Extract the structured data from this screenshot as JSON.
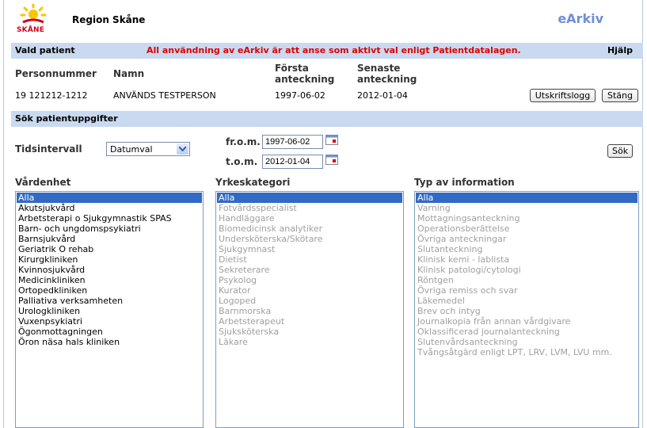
{
  "header": {
    "logo_text": "SKÅNE",
    "region": "Region Skåne",
    "app_title": "eArkiv"
  },
  "patient_bar": {
    "title": "Vald patient",
    "warning": "All användning av eArkiv är att anse som aktivt val enligt Patientdatalagen.",
    "help": "Hjälp"
  },
  "patient": {
    "headers": {
      "personnummer": "Personnummer",
      "namn": "Namn",
      "forsta_1": "Första",
      "forsta_2": "anteckning",
      "senaste_1": "Senaste",
      "senaste_2": "anteckning"
    },
    "personnummer": "19 121212-1212",
    "namn": "ANVÄNDS TESTPERSON",
    "forsta": "1997-06-02",
    "senaste": "2012-01-04",
    "log_button": "Utskriftslogg",
    "close_button": "Stäng"
  },
  "search_bar": {
    "title": "Sök patientuppgifter"
  },
  "search": {
    "interval_label": "Tidsintervall",
    "interval_value": "Datumval",
    "from_label": "fr.o.m.",
    "from_value": "1997-06-02",
    "to_label": "t.o.m.",
    "to_value": "2012-01-04",
    "search_button": "Sök"
  },
  "lists": {
    "vardenhet": {
      "label": "Vårdenhet",
      "items": [
        "Alla",
        "Akutsjukvård",
        "Arbetsterapi o Sjukgymnastik SPAS",
        "Barn- och ungdomspsykiatri",
        "Barnsjukvård",
        "Geriatrik O rehab",
        "Kirurgkliniken",
        "Kvinnosjukvård",
        "Medicinkliniken",
        "Ortopedkliniken",
        "Palliativa verksamheten",
        "Urologkliniken",
        "Vuxenpsykiatri",
        "Ögonmottagningen",
        "Öron näsa hals kliniken"
      ]
    },
    "yrkeskategori": {
      "label": "Yrkeskategori",
      "items": [
        "Alla",
        "Fotvårdsspecialist",
        "Handläggare",
        "Biomedicinsk analytiker",
        "Undersköterska/Skötare",
        "Sjukgymnast",
        "Dietist",
        "Sekreterare",
        "Psykolog",
        "Kurator",
        "Logoped",
        "Barnmorska",
        "Arbetsterapeut",
        "Sjuksköterska",
        "Läkare"
      ]
    },
    "typ": {
      "label": "Typ av information",
      "items": [
        "Alla",
        "Varning",
        "Mottagningsanteckning",
        "Operationsberättelse",
        "Övriga anteckningar",
        "Slutanteckning",
        "Klinisk kemi - lablista",
        "Klinisk patologi/cytologi",
        "Röntgen",
        "Övriga remiss och svar",
        "Läkemedel",
        "Brev och intyg",
        "Journalkopia från annan vårdgivare",
        "Oklassificerad journalanteckning",
        "Slutenvårdsanteckning",
        "Tvångsåtgärd enligt LPT, LRV, LVM, LVU mm."
      ]
    }
  }
}
